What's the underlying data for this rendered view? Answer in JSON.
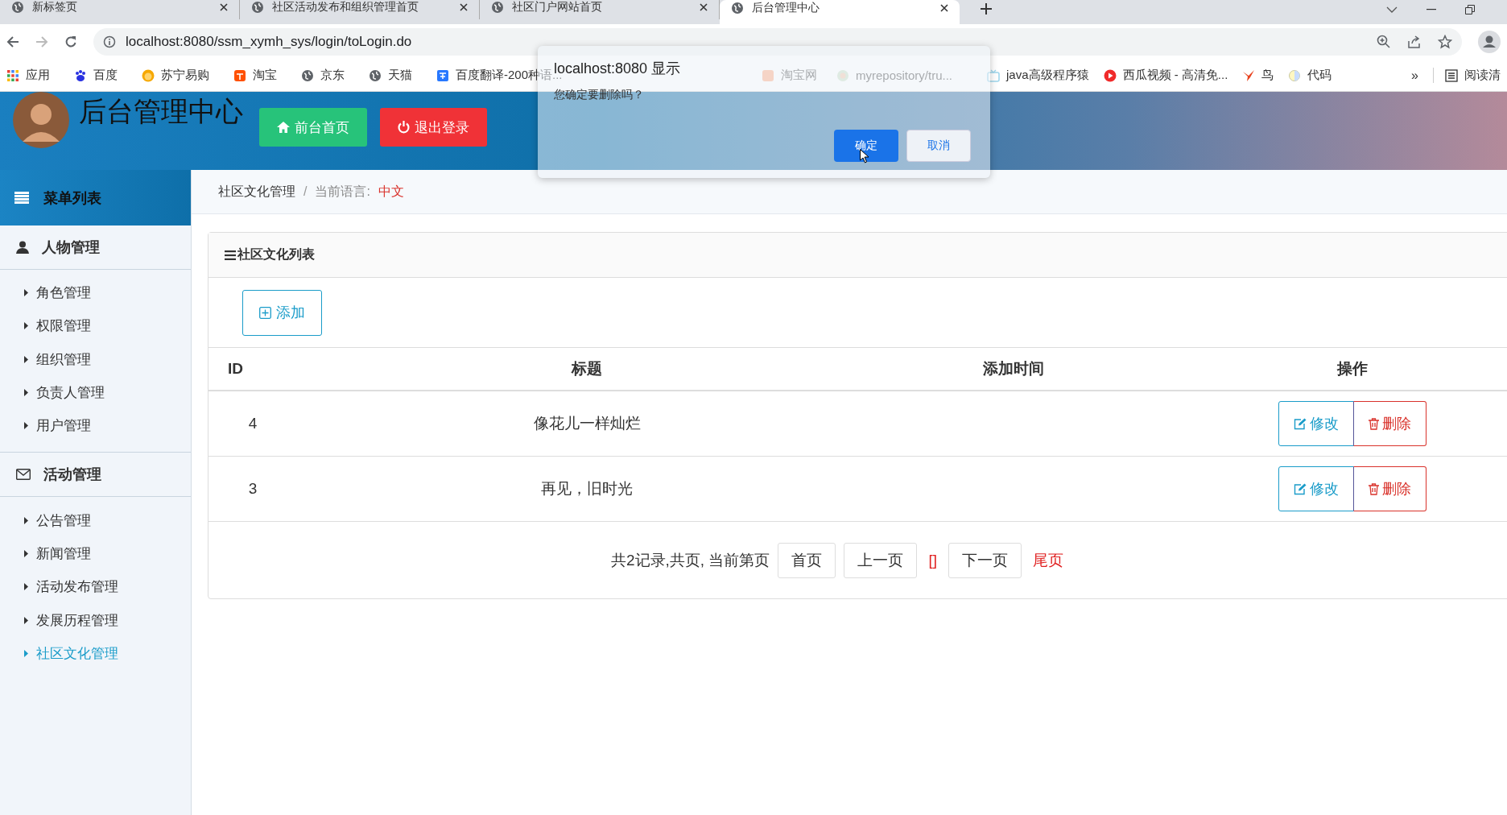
{
  "browser": {
    "tabs": [
      {
        "title": "新标签页",
        "selected": false
      },
      {
        "title": "社区活动发布和组织管理首页",
        "selected": false
      },
      {
        "title": "社区门户网站首页",
        "selected": false
      },
      {
        "title": "后台管理中心",
        "selected": true
      }
    ],
    "address": "localhost:8080/ssm_xymh_sys/login/toLogin.do",
    "bookmarks": [
      {
        "label": "应用"
      },
      {
        "label": "百度"
      },
      {
        "label": "苏宁易购"
      },
      {
        "label": "淘宝"
      },
      {
        "label": "京东"
      },
      {
        "label": "天猫"
      },
      {
        "label": "百度翻译-200种语..."
      },
      {
        "label": "淘宝网"
      },
      {
        "label": "myrepository/tru..."
      },
      {
        "label": "java高级程序猿"
      },
      {
        "label": "西瓜视频 - 高清免..."
      },
      {
        "label": "鸟"
      },
      {
        "label": "代码"
      }
    ],
    "more": "»",
    "reading_list": "阅读清"
  },
  "header": {
    "title": "后台管理中心",
    "buttons": [
      {
        "kind": "home",
        "label": "前台首页"
      },
      {
        "kind": "logout",
        "label": "退出登录"
      }
    ]
  },
  "sidebar": {
    "title": "菜单列表",
    "groups": [
      {
        "label": "人物管理",
        "items": [
          {
            "label": "角色管理",
            "selected": false
          },
          {
            "label": "权限管理",
            "selected": false
          },
          {
            "label": "组织管理",
            "selected": false
          },
          {
            "label": "负责人管理",
            "selected": false
          },
          {
            "label": "用户管理",
            "selected": false
          }
        ]
      },
      {
        "label": "活动管理",
        "items": [
          {
            "label": "公告管理",
            "selected": false
          },
          {
            "label": "新闻管理",
            "selected": false
          },
          {
            "label": "活动发布管理",
            "selected": false
          },
          {
            "label": "发展历程管理",
            "selected": false
          },
          {
            "label": "社区文化管理",
            "selected": true
          }
        ]
      }
    ]
  },
  "breadcrumb": {
    "section": "社区文化管理",
    "separator": "/",
    "language_label": "当前语言:",
    "language": "中文"
  },
  "panel": {
    "title": "社区文化列表",
    "add_button": "添加",
    "table": {
      "columns": [
        "ID",
        "标题",
        "添加时间",
        "操作"
      ],
      "rows": [
        {
          "id": "4",
          "title": "像花儿一样灿烂",
          "actions": [
            {
              "kind": "edit",
              "label": "修改"
            },
            {
              "kind": "delete",
              "label": "删除"
            }
          ]
        },
        {
          "id": "3",
          "title": "再见，旧时光",
          "actions": [
            {
              "kind": "edit",
              "label": "修改"
            },
            {
              "kind": "delete",
              "label": "删除"
            }
          ]
        }
      ]
    },
    "pagination": [
      {
        "kind": "text",
        "label": "共2记录,共页, 当前第页"
      },
      {
        "kind": "button",
        "label": "首页"
      },
      {
        "kind": "button",
        "label": "上一页"
      },
      {
        "kind": "current",
        "label": "[]"
      },
      {
        "kind": "button",
        "label": "下一页"
      },
      {
        "kind": "link",
        "label": "尾页"
      }
    ]
  },
  "dialog": {
    "title": "localhost:8080 显示",
    "message": "您确定要删除吗？",
    "buttons": [
      {
        "kind": "primary",
        "label": "确定"
      },
      {
        "kind": "default",
        "label": "取消"
      }
    ]
  }
}
